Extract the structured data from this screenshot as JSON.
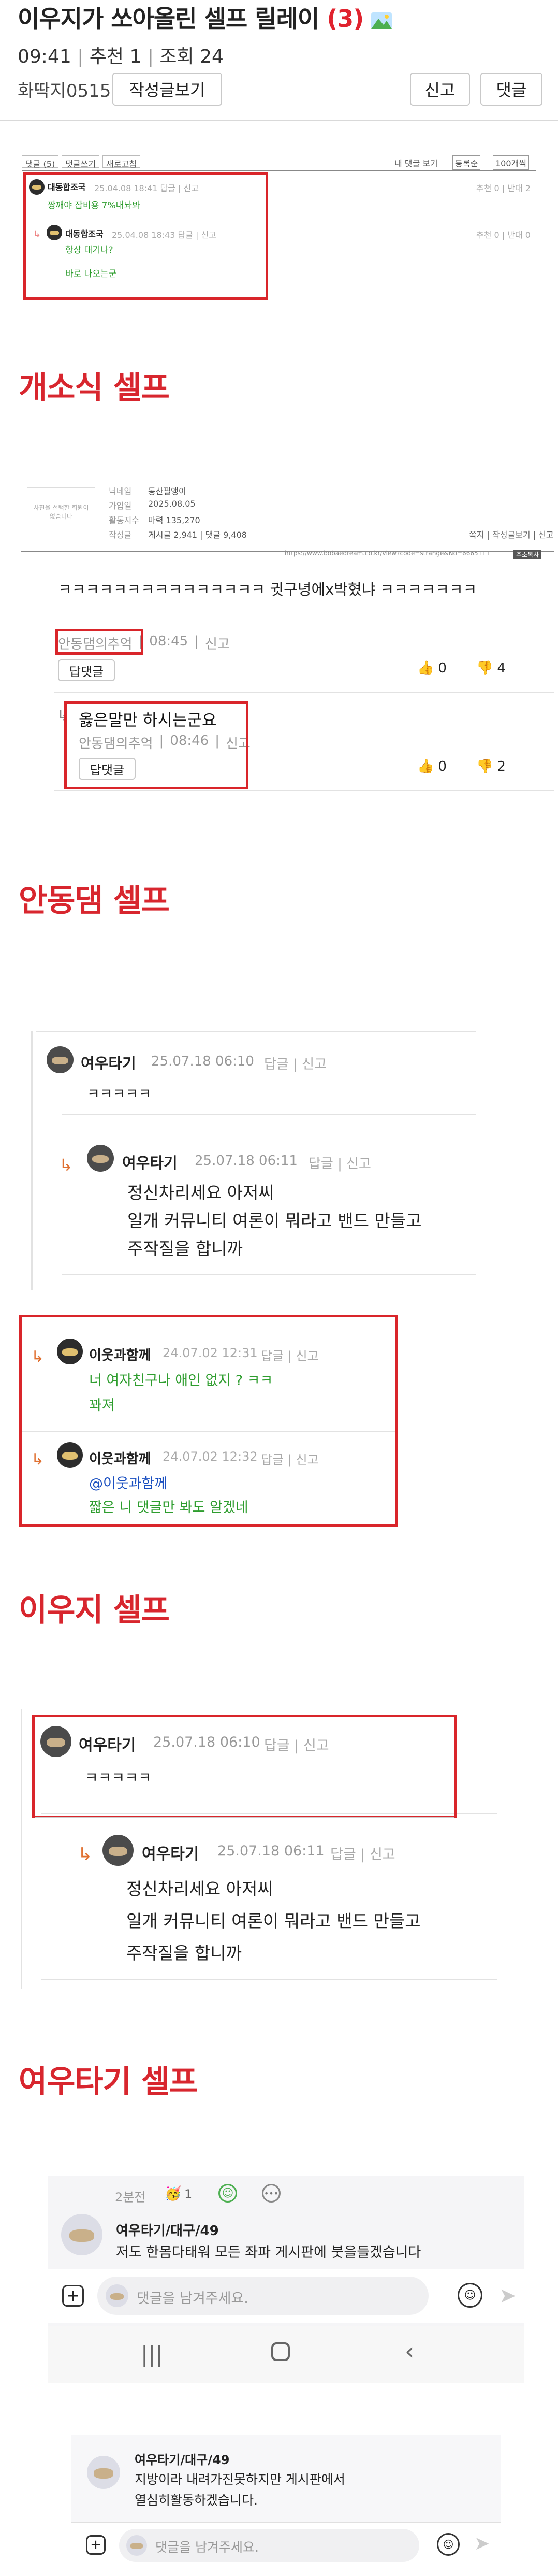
{
  "post": {
    "title": "이우지가 쏘아올린 셀프 릴레이",
    "count": "(3)",
    "time": "09:41",
    "recommend": "추천 1",
    "views": "조회 24",
    "author": "화딱지0515",
    "view_posts_btn": "작성글보기",
    "report_btn": "신고",
    "comment_btn": "댓글"
  },
  "shot1": {
    "toolbar": [
      "댓글 (5)",
      "댓글쓰기",
      "새로고침"
    ],
    "right_toolbar": "내 댓글 보기",
    "sort": "등록순",
    "page_size": "100개씩",
    "c1_name": "대동합조국",
    "c1_meta": "25.04.08 18:41  답글 | 신고",
    "c1_text": "짱깨야 잡비용 7%내놔봐",
    "c1_right": "추천 0 | 반대 2",
    "c2_name": "대동합조국",
    "c2_meta": "25.04.08 18:43  답글 | 신고",
    "c2_text1": "항상 대기나?",
    "c2_text2": "바로 나오는군",
    "c2_right": "추천 0 | 반대 0"
  },
  "h1": "개소식 셀프",
  "shot2": {
    "logo_text": "사진을 선택한 회원이 없습니다",
    "rows": [
      {
        "label": "닉네임",
        "value": "동산필앵이"
      },
      {
        "label": "가입일",
        "value": "2025.08.05"
      },
      {
        "label": "활동지수",
        "value": "마력 135,270"
      },
      {
        "label": "작성글",
        "value": "게시글 2,941 | 댓글 9,408"
      }
    ],
    "links": "쪽지 | 작성글보기 | 신고",
    "url": "https://www.bobaedream.co.kr/view?code=strange&No=6665111",
    "url_btn": "주소복사",
    "c1_text": "ㅋㅋㅋㅋㅋㅋㅋㅋㅋㅋㅋㅋㅋㅋㅋ 귓구녕에x박혔냐 ㅋㅋㅋㅋㅋㅋㅋ",
    "c1_author": "안동댐의추억",
    "c1_time": "08:45",
    "c1_report": "신고",
    "c1_reply_btn": "답댓글",
    "c1_up": "0",
    "c1_down": "4",
    "c2_text": "옳은말만 하시는군요",
    "c2_author": "안동댐의추억",
    "c2_time": "08:46",
    "c2_report": "신고",
    "c2_reply_btn": "답댓글",
    "c2_up": "0",
    "c2_down": "2"
  },
  "h2": "안동댐 셀프",
  "shot3": {
    "c1_name": "여우타기",
    "c1_meta": "25.07.18 06:10",
    "c1_actions": "답글 | 신고",
    "c1_text": "ㅋㅋㅋㅋㅋ",
    "c2_name": "여우타기",
    "c2_meta": "25.07.18 06:11",
    "c2_actions": "답글 | 신고",
    "c2_lines": [
      "정신차리세요 아저씨",
      "일개 커뮤니티 여론이 뭐라고 밴드 만들고",
      "주작질을 합니까"
    ]
  },
  "shot4": {
    "c1_name": "이웃과함께",
    "c1_meta": "24.07.02 12:31",
    "c1_actions": "답글 | 신고",
    "c1_lines": [
      "너 여자친구나 애인 없지 ? ㅋㅋ",
      "꽈져"
    ],
    "c2_name": "이웃과함께",
    "c2_meta": "24.07.02 12:32",
    "c2_actions": "답글 | 신고",
    "c2_mention": "@이웃과함께",
    "c2_text": "짧은 니 댓글만 봐도 알겠네"
  },
  "h3": "이우지 셀프",
  "shot5": {
    "c1_name": "여우타기",
    "c1_meta": "25.07.18 06:10",
    "c1_actions": "답글 | 신고",
    "c1_text": "ㅋㅋㅋㅋㅋ",
    "c2_name": "여우타기",
    "c2_meta": "25.07.18 06:11",
    "c2_actions": "답글 | 신고",
    "c2_lines": [
      "정신차리세요 아저씨",
      "일개 커뮤니티 여론이 뭐라고 밴드 만들고",
      "주작질을 합니까"
    ]
  },
  "h4": "여우타기 셀프",
  "shot6": {
    "time_ago": "2분전",
    "reaction_count": "1",
    "user1": "여우타기/대구/49",
    "text1": "저도 한몸다태워 모든 좌파 게시판에 붓을들겠습니다",
    "input_placeholder": "댓글을 남겨주세요.",
    "user2": "여우타기/대구/49",
    "text2_lines": [
      "지방이라 내려가진못하지만 게시판에서",
      "열심히활동하겠습니다."
    ],
    "input_placeholder2": "댓글을 남겨주세요."
  }
}
